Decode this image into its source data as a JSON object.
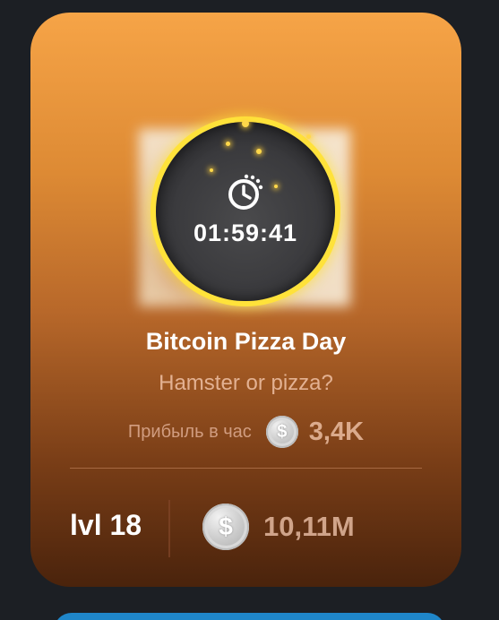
{
  "card": {
    "timer": "01:59:41",
    "title": "Bitcoin Pizza Day",
    "subtitle": "Hamster or pizza?",
    "profit_label": "Прибыль в час",
    "profit_value": "3,4K",
    "level": "lvl 18",
    "price": "10,11M",
    "coin_symbol": "$",
    "icons": {
      "timer": "timer-icon",
      "coin": "coin-icon"
    },
    "colors": {
      "gradient_top": "#f6a447",
      "gradient_bottom": "#4a230c",
      "ring": "#ffe23a",
      "background": "#1c1f24",
      "next_card": "#1f86c9"
    }
  }
}
